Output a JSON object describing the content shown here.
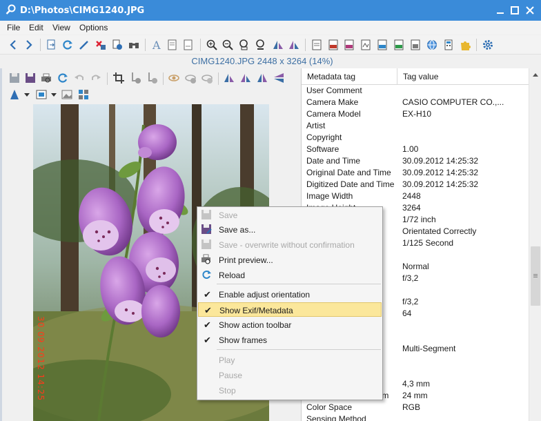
{
  "window": {
    "title": "D:\\Photos\\CIMG1240.JPG"
  },
  "menubar": {
    "items": [
      "File",
      "Edit",
      "View",
      "Options"
    ]
  },
  "toolbar": {
    "icons": [
      "back-icon",
      "forward-icon",
      "open-icon",
      "refresh-icon",
      "edit-icon",
      "delete-icon",
      "file-info-icon",
      "find-icon",
      "text-icon",
      "page-icon",
      "page-icon-2",
      "zoom-in-icon",
      "zoom-out-icon",
      "fit-icon",
      "zoom-actual-icon",
      "flip-h-icon",
      "flip-v-icon",
      "export-doc-icon",
      "export-html-icon",
      "export-hex-icon",
      "export-pdf-icon",
      "export-rtf-icon",
      "export-xls-icon",
      "export-xml-icon",
      "web-icon",
      "calc-icon",
      "plugin-icon",
      "settings-icon"
    ]
  },
  "image_info": "CIMG1240.JPG   2448 x 3264 (14%)",
  "photo": {
    "date_stamp": "30.09.2012 14:25"
  },
  "metadata": {
    "col_tag": "Metadata tag",
    "col_value": "Tag value",
    "rows": [
      {
        "tag": "User Comment",
        "value": ""
      },
      {
        "tag": "Camera Make",
        "value": "CASIO COMPUTER CO.,..."
      },
      {
        "tag": "Camera Model",
        "value": "EX-H10"
      },
      {
        "tag": "Artist",
        "value": ""
      },
      {
        "tag": "Copyright",
        "value": ""
      },
      {
        "tag": "Software",
        "value": "1.00"
      },
      {
        "tag": "Date and Time",
        "value": "30.09.2012 14:25:32"
      },
      {
        "tag": "Original Date and Time",
        "value": "30.09.2012 14:25:32"
      },
      {
        "tag": "Digitized Date and Time",
        "value": "30.09.2012 14:25:32"
      },
      {
        "tag": "Image Width",
        "value": "2448"
      },
      {
        "tag": "Image Height",
        "value": "3264"
      },
      {
        "tag": "",
        "value": "1/72 inch"
      },
      {
        "tag": "",
        "value": "Orientated Correctly"
      },
      {
        "tag": "",
        "value": "1/125 Second"
      },
      {
        "tag": "",
        "value": ""
      },
      {
        "tag": "",
        "value": "Normal"
      },
      {
        "tag": "",
        "value": "f/3,2"
      },
      {
        "tag": "",
        "value": ""
      },
      {
        "tag": "",
        "value": "f/3,2"
      },
      {
        "tag": "",
        "value": "64"
      },
      {
        "tag": "",
        "value": ""
      },
      {
        "tag": "",
        "value": ""
      },
      {
        "tag": "",
        "value": "Multi-Segment"
      },
      {
        "tag": "",
        "value": ""
      },
      {
        "tag": "",
        "value": ""
      },
      {
        "tag": "",
        "value": "4,3 mm"
      },
      {
        "tag": "ilm",
        "value": "24 mm"
      },
      {
        "tag": "Color Space",
        "value": "RGB"
      },
      {
        "tag": "Sensing Method",
        "value": ""
      }
    ]
  },
  "context_menu": {
    "save": "Save",
    "save_as": "Save as...",
    "save_overwrite": "Save - overwrite without confirmation",
    "print_preview": "Print preview...",
    "reload": "Reload",
    "enable_adjust": "Enable adjust orientation",
    "show_exif": "Show Exif/Metadata",
    "show_action_toolbar": "Show action toolbar",
    "show_frames": "Show frames",
    "play": "Play",
    "pause": "Pause",
    "stop": "Stop"
  },
  "colors": {
    "titlebar": "#3a8bd9",
    "highlight": "#fbe79b",
    "info_text": "#3d6fa3"
  }
}
